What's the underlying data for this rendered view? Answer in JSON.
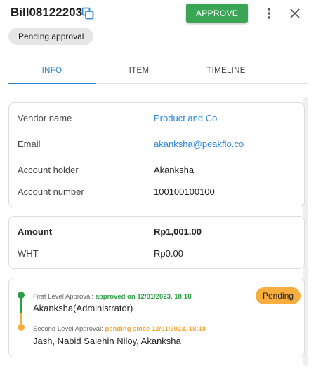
{
  "header": {
    "bill_id": "Bill08122203",
    "copy_icon": "copy-icon",
    "approve_label": "APPROVE",
    "more_icon": "more-vert-icon",
    "close_icon": "close-icon"
  },
  "status": "Pending approval",
  "tabs": [
    {
      "label": "INFO",
      "active": true
    },
    {
      "label": "ITEM",
      "active": false
    },
    {
      "label": "TIMELINE",
      "active": false
    }
  ],
  "vendor_card": {
    "rows": [
      {
        "label": "Vendor name",
        "value": "Product and Co"
      },
      {
        "label": "Email",
        "value": "akanksha@peakflo.co"
      },
      {
        "label": "Account holder",
        "value": "Akanksha"
      },
      {
        "label": "Account number",
        "value": "100100100100"
      }
    ]
  },
  "amount_card": {
    "amount_label": "Amount",
    "amount_value": "Rp1,001.00",
    "wht_label": "WHT",
    "wht_value": "Rp0.00"
  },
  "approval_card": {
    "badge": "Pending",
    "first": {
      "prefix": "First Level Approval: ",
      "status": "approved on 12/01/2023, 18:18",
      "approver": "Akanksha(Administrator)"
    },
    "second": {
      "prefix": "Second Level Approval: ",
      "status": "pending since 12/01/2023, 18:18",
      "approvers": "Jash, Nabid Salehin Niloy, Akanksha"
    }
  },
  "colors": {
    "accent": "#2d7fd0",
    "approve": "#3aa655",
    "approved_green": "#2e9e46",
    "pending_orange": "#f7ae3f"
  }
}
